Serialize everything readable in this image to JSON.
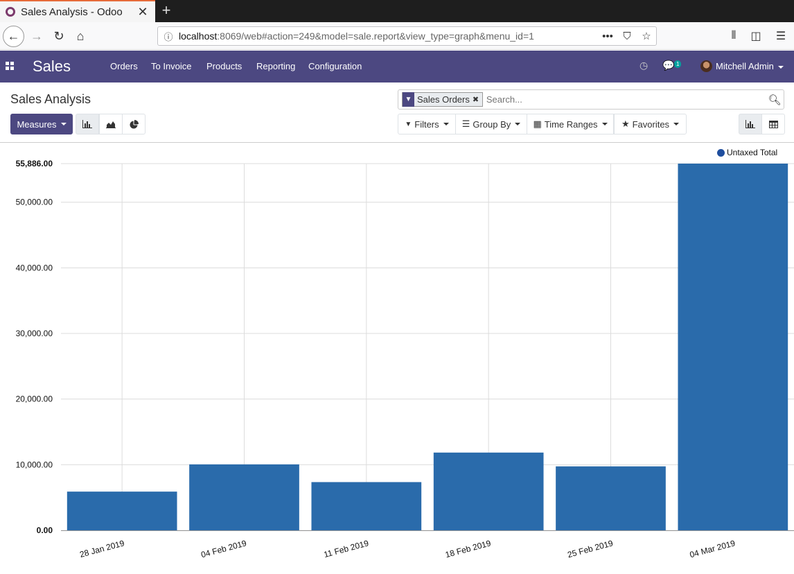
{
  "browser": {
    "tab_title": "Sales Analysis - Odoo",
    "url_host": "localhost",
    "url_rest": ":8069/web#action=249&model=sale.report&view_type=graph&menu_id=1"
  },
  "odoo_nav": {
    "app_name": "Sales",
    "menu": [
      "Orders",
      "To Invoice",
      "Products",
      "Reporting",
      "Configuration"
    ],
    "chat_badge": "1",
    "user_name": "Mitchell Admin"
  },
  "control_panel": {
    "breadcrumb": "Sales Analysis",
    "measures_label": "Measures",
    "facet_label": "Sales Orders",
    "search_placeholder": "Search...",
    "filters_label": "Filters",
    "groupby_label": "Group By",
    "timeranges_label": "Time Ranges",
    "favorites_label": "Favorites"
  },
  "colors": {
    "bar": "#2a6bab",
    "brand": "#4c4881"
  },
  "chart_data": {
    "type": "bar",
    "categories": [
      "28 Jan 2019",
      "04 Feb 2019",
      "11 Feb 2019",
      "18 Feb 2019",
      "25 Feb 2019",
      "04 Mar 2019"
    ],
    "series": [
      {
        "name": "Untaxed Total",
        "values": [
          5900,
          10050,
          7350,
          11850,
          9750,
          55886
        ]
      }
    ],
    "yticks": [
      "0.00",
      "10,000.00",
      "20,000.00",
      "30,000.00",
      "40,000.00",
      "50,000.00",
      "55,886.00"
    ],
    "ylim": [
      0,
      55886
    ],
    "grid": true,
    "legend_position": "top-right"
  }
}
